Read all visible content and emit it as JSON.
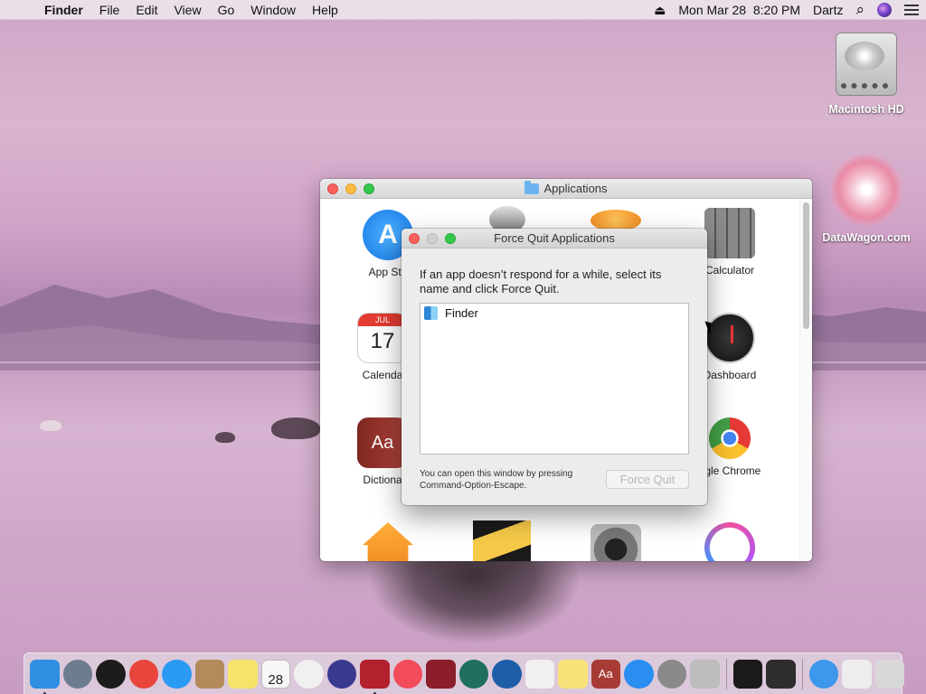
{
  "menubar": {
    "apple_glyph": "",
    "app_name": "Finder",
    "menus": [
      "File",
      "Edit",
      "View",
      "Go",
      "Window",
      "Help"
    ],
    "eject_glyph": "⏏",
    "datetime": "Mon Mar 28  8:20 PM",
    "user": "Dartz",
    "search_glyph": "⌕"
  },
  "desktop": {
    "icons": [
      {
        "label": "Macintosh HD"
      },
      {
        "label": "DataWagon.com"
      }
    ]
  },
  "applications_window": {
    "title": "Applications",
    "items": [
      {
        "label": "App Sto",
        "icon": "app-store-icon",
        "color": "#1e8ef0"
      },
      {
        "label": "",
        "icon": "automator-icon",
        "color": "#c8c8c8"
      },
      {
        "label": "",
        "icon": "books-icon",
        "color": "#f7a032"
      },
      {
        "label": "Calculator",
        "icon": "calculator-icon",
        "color": "#555555"
      },
      {
        "label": "Calenda",
        "icon": "calendar-icon",
        "color": "#ffffff"
      },
      {
        "label": "Dashboard",
        "icon": "dashboard-icon",
        "color": "#222222"
      },
      {
        "label": "Dictiona",
        "icon": "dictionary-icon",
        "color": "#a33a34"
      },
      {
        "label": "ogle Chrome",
        "icon": "chrome-icon",
        "color": "#e53935"
      },
      {
        "label": "",
        "icon": "home-icon",
        "color": "#f39c2a"
      },
      {
        "label": "",
        "icon": "cheese-icon",
        "color": "#1a1a1a"
      },
      {
        "label": "",
        "icon": "image-capture-icon",
        "color": "#9a9a9a"
      },
      {
        "label": "",
        "icon": "itunes-icon",
        "color": "#f3f3f3"
      }
    ],
    "calendar": {
      "month": "JUL",
      "day": "17"
    },
    "dictionary_glyph": "Aa"
  },
  "force_quit": {
    "title": "Force Quit Applications",
    "message": "If an app doesn’t respond for a while, select its name and click Force Quit.",
    "apps": [
      "Finder"
    ],
    "footer": "You can open this window by pressing Command-Option-Escape.",
    "button": "Force Quit"
  },
  "dock": {
    "calendar_day": "28",
    "dictionary_glyph": "Aa",
    "items": [
      {
        "name": "finder-icon",
        "color": "#2f8fe3",
        "running": true
      },
      {
        "name": "launchpad-icon",
        "color": "#6d7d8f",
        "running": false
      },
      {
        "name": "dashboard-icon",
        "color": "#1c1c1c",
        "running": false
      },
      {
        "name": "chrome-icon",
        "color": "#e8453c",
        "running": false
      },
      {
        "name": "safari-icon",
        "color": "#2a9af3",
        "running": false
      },
      {
        "name": "contacts-icon",
        "color": "#b28a5c",
        "running": false
      },
      {
        "name": "stickies-icon",
        "color": "#f5e46a",
        "running": false
      },
      {
        "name": "calendar-icon",
        "color": "#f7f7f7",
        "running": false
      },
      {
        "name": "photos-icon",
        "color": "#f0f0f0",
        "running": false
      },
      {
        "name": "siri-icon",
        "color": "#3a3a8f",
        "running": false
      },
      {
        "name": "photo-booth-icon",
        "color": "#b3212d",
        "running": true
      },
      {
        "name": "news-icon",
        "color": "#f24b5a",
        "running": false
      },
      {
        "name": "photo-booth-2-icon",
        "color": "#8b1e2a",
        "running": false
      },
      {
        "name": "time-machine-icon",
        "color": "#1f6f5f",
        "running": false
      },
      {
        "name": "quicktime-icon",
        "color": "#1d5ea8",
        "running": false
      },
      {
        "name": "textedit-icon",
        "color": "#f0f0f0",
        "running": false
      },
      {
        "name": "notes-icon",
        "color": "#f8e27a",
        "running": false
      },
      {
        "name": "dictionary-icon",
        "color": "#a83b35",
        "running": false
      },
      {
        "name": "app-store-icon",
        "color": "#2a8ef1",
        "running": false
      },
      {
        "name": "system-preferences-icon",
        "color": "#8a8a8a",
        "running": false
      },
      {
        "name": "automator-icon",
        "color": "#bdbdbd",
        "running": false
      },
      {
        "name": "cheese-icon",
        "color": "#1a1a1a",
        "running": false
      },
      {
        "name": "activity-monitor-icon",
        "color": "#2d2d2d",
        "running": false
      },
      {
        "name": "downloads-folder-icon",
        "color": "#3d97ea",
        "running": false
      },
      {
        "name": "documents-icon",
        "color": "#ededed",
        "running": false
      },
      {
        "name": "trash-icon",
        "color": "#d8d8d8",
        "running": false
      }
    ]
  }
}
